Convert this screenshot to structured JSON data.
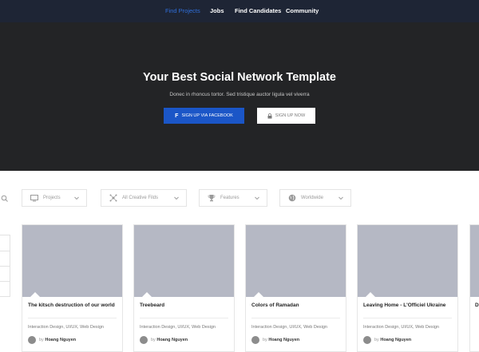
{
  "nav": {
    "items": [
      {
        "label": "Find Projects",
        "active": true
      },
      {
        "label": "Jobs",
        "active": false
      },
      {
        "label": "Find Candidates",
        "active": false
      },
      {
        "label": "Community",
        "active": false
      }
    ]
  },
  "hero": {
    "title": "Your Best Social Network Template",
    "subtitle": "Donec in rhoncus tortor. Sed tristique auctor ligula vel viverra",
    "facebook_button": "SIGN UP VIA FACEBOOK",
    "signup_button": "SIGN UP NOW"
  },
  "filters": [
    {
      "label": "Projects",
      "icon": "monitor-icon"
    },
    {
      "label": "All Creative Filds",
      "icon": "network-icon"
    },
    {
      "label": "Features",
      "icon": "trophy-icon"
    },
    {
      "label": "Worldwide",
      "icon": "globe-icon"
    }
  ],
  "cards": [
    {
      "title": "The kitsch destruction of our world",
      "tags": "Interaction Design, UI/UX, Web Design",
      "by": "by",
      "author": "Hoang Nguyen"
    },
    {
      "title": "Treebeard",
      "tags": "Interaction Design, UI/UX, Web Design",
      "by": "by",
      "author": "Hoang Nguyen"
    },
    {
      "title": "Colors of Ramadan",
      "tags": "Interaction Design, UI/UX, Web Design",
      "by": "by",
      "author": "Hoang Nguyen"
    },
    {
      "title": "Leaving Home - L'Officiel Ukraine",
      "tags": "Interaction Design, UI/UX, Web Design",
      "by": "by",
      "author": "Hoang Nguyen"
    },
    {
      "title": "D"
    }
  ],
  "colors": {
    "nav_bg": "#1e2535",
    "hero_bg": "#232426",
    "accent": "#1b56c7",
    "active_link": "#2f6fdc",
    "card_image": "#b5b8c4"
  }
}
